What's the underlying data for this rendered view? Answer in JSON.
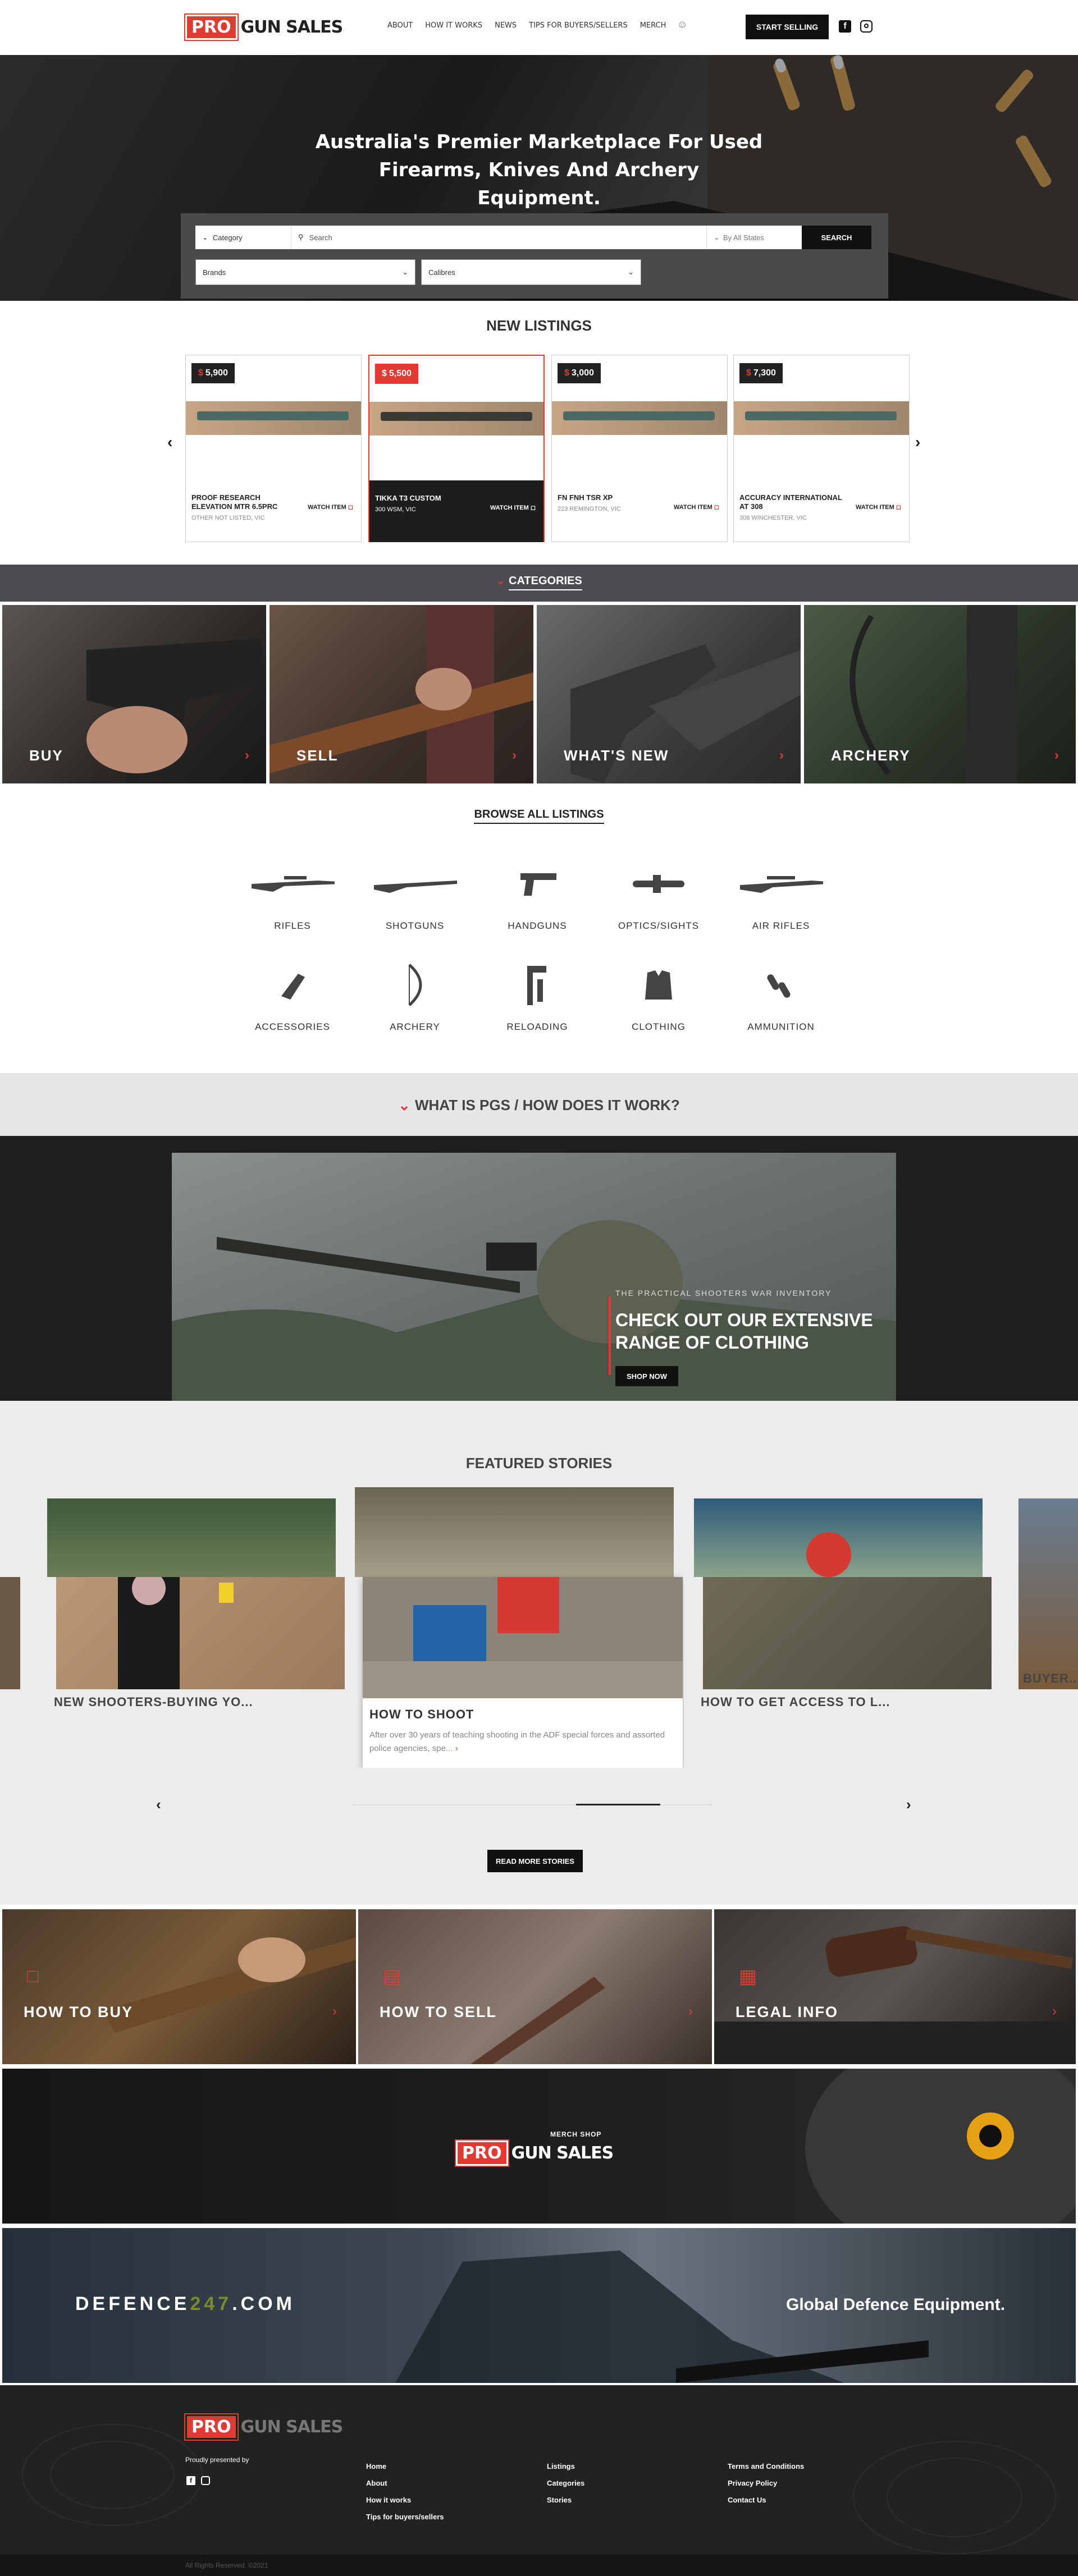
{
  "header": {
    "logo_pro": "PRO",
    "logo_rest": "GUN SALES",
    "nav": [
      "ABOUT",
      "HOW IT WORKS",
      "NEWS",
      "TIPS FOR BUYERS/SELLERS",
      "MERCH"
    ],
    "start_selling": "START SELLING"
  },
  "hero": {
    "title_line1": "Australia's Premier Marketplace For Used",
    "title_line2": "Firearms, Knives And Archery Equipment.",
    "category_select": "Category",
    "search_placeholder": "Search",
    "states_select": "By All States",
    "search_button": "SEARCH",
    "brands_select": "Brands",
    "calibres_select": "Calibres"
  },
  "new_listings": {
    "title": "NEW LISTINGS",
    "items": [
      {
        "price": "5,900",
        "name": "PROOF RESEARCH ELEVATION MTR 6.5PRC",
        "sub": "OTHER NOT LISTED, VIC",
        "watch": "WATCH ITEM"
      },
      {
        "price": "5,500",
        "name": "TIKKA T3 CUSTOM",
        "sub": "300 WSM, VIC",
        "watch": "WATCH ITEM"
      },
      {
        "price": "3,000",
        "name": "FN FNH TSR XP",
        "sub": "223 REMINGTON, VIC",
        "watch": "WATCH ITEM"
      },
      {
        "price": "7,300",
        "name": "ACCURACY INTERNATIONAL AT 308",
        "sub": "308 WINCHESTER, VIC",
        "watch": "WATCH ITEM"
      }
    ]
  },
  "categories": {
    "title": "CATEGORIES",
    "tiles": [
      "BUY",
      "SELL",
      "WHAT'S NEW",
      "ARCHERY"
    ]
  },
  "browse": {
    "title": "BROWSE ALL LISTINGS",
    "items": [
      "RIFLES",
      "SHOTGUNS",
      "HANDGUNS",
      "OPTICS/SIGHTS",
      "AIR RIFLES",
      "ACCESSORIES",
      "ARCHERY",
      "RELOADING",
      "CLOTHING",
      "AMMUNITION"
    ]
  },
  "how": {
    "title": "WHAT IS PGS / HOW DOES IT WORK?",
    "slide_kicker": "THE PRACTICAL SHOOTERS WAR INVENTORY",
    "slide_title_line1": "CHECK OUT OUR EXTENSIVE",
    "slide_title_line2": "RANGE OF CLOTHING",
    "slide_button": "SHOP NOW"
  },
  "featured": {
    "title": "FEATURED STORIES",
    "stories": [
      {
        "title": "NEW SHOOTERS-BUYING YO..."
      },
      {
        "title": "HOW TO SHOOT",
        "excerpt": "After over 30 years of teaching shooting in the ADF special forces and assorted police agencies, spe..."
      },
      {
        "title": "HOW TO GET ACCESS TO L..."
      },
      {
        "title": "BUYER..."
      }
    ],
    "read_more": "READ MORE STORIES"
  },
  "info_tiles": [
    "HOW TO BUY",
    "HOW TO SELL",
    "LEGAL INFO"
  ],
  "merch_banner": {
    "kicker": "MERCH SHOP",
    "logo_pro": "PRO",
    "logo_rest": "GUN SALES"
  },
  "defence_banner": {
    "left": "DEFENCE",
    "mid": "247",
    "right": ".COM",
    "tagline": "Global Defence Equipment."
  },
  "footer": {
    "logo_pro": "PRO",
    "logo_rest": "GUN SALES",
    "presented": "Proudly presented by",
    "col1": [
      "Home",
      "About",
      "How it works",
      "Tips for buyers/sellers"
    ],
    "col2": [
      "Listings",
      "Categories",
      "Stories"
    ],
    "col3": [
      "Terms and Conditions",
      "Privacy Policy",
      "Contact Us"
    ],
    "copyright": "All Rights Reserved. ©2021"
  },
  "colors": {
    "accent": "#e03a32",
    "dark": "#1e1e1e",
    "bar": "#4c4b50"
  }
}
